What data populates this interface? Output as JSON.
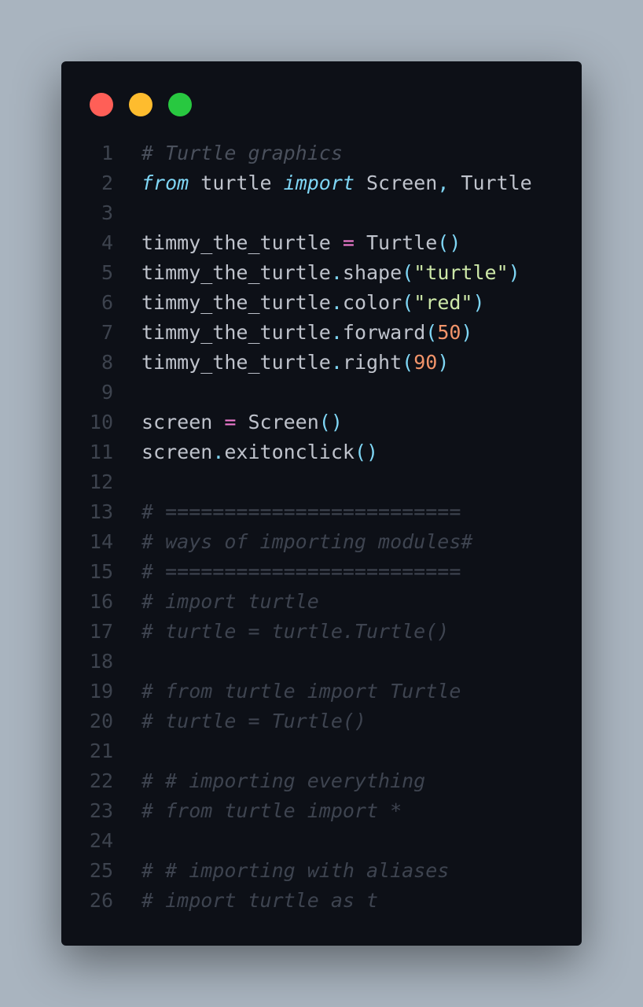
{
  "window": {
    "dots": [
      {
        "name": "close",
        "color": "#ff5f57"
      },
      {
        "name": "minimize",
        "color": "#febc2e"
      },
      {
        "name": "zoom",
        "color": "#28c840"
      }
    ]
  },
  "colors": {
    "background": "#a9b4bf",
    "editor": "#0d1017",
    "keyword": "#7fd6f5",
    "operator": "#f07bd0",
    "string": "#cde8a8",
    "number": "#f2946a",
    "comment": "#4a505c",
    "text": "#bfc3cc"
  },
  "lines": [
    {
      "n": "1",
      "tokens": [
        {
          "t": "comment",
          "v": "# Turtle graphics"
        }
      ]
    },
    {
      "n": "2",
      "tokens": [
        {
          "t": "kw",
          "v": "from"
        },
        {
          "t": "plain",
          "v": " turtle "
        },
        {
          "t": "kw",
          "v": "import"
        },
        {
          "t": "plain",
          "v": " Screen"
        },
        {
          "t": "punc",
          "v": ","
        },
        {
          "t": "plain",
          "v": " Turtle"
        }
      ]
    },
    {
      "n": "3",
      "tokens": []
    },
    {
      "n": "4",
      "tokens": [
        {
          "t": "plain",
          "v": "timmy_the_turtle "
        },
        {
          "t": "op",
          "v": "="
        },
        {
          "t": "plain",
          "v": " Turtle"
        },
        {
          "t": "punc",
          "v": "()"
        }
      ]
    },
    {
      "n": "5",
      "tokens": [
        {
          "t": "plain",
          "v": "timmy_the_turtle"
        },
        {
          "t": "punc",
          "v": "."
        },
        {
          "t": "plain",
          "v": "shape"
        },
        {
          "t": "punc",
          "v": "("
        },
        {
          "t": "str",
          "v": "\"turtle\""
        },
        {
          "t": "punc",
          "v": ")"
        }
      ]
    },
    {
      "n": "6",
      "tokens": [
        {
          "t": "plain",
          "v": "timmy_the_turtle"
        },
        {
          "t": "punc",
          "v": "."
        },
        {
          "t": "plain",
          "v": "color"
        },
        {
          "t": "punc",
          "v": "("
        },
        {
          "t": "str",
          "v": "\"red\""
        },
        {
          "t": "punc",
          "v": ")"
        }
      ]
    },
    {
      "n": "7",
      "tokens": [
        {
          "t": "plain",
          "v": "timmy_the_turtle"
        },
        {
          "t": "punc",
          "v": "."
        },
        {
          "t": "plain",
          "v": "forward"
        },
        {
          "t": "punc",
          "v": "("
        },
        {
          "t": "num",
          "v": "50"
        },
        {
          "t": "punc",
          "v": ")"
        }
      ]
    },
    {
      "n": "8",
      "tokens": [
        {
          "t": "plain",
          "v": "timmy_the_turtle"
        },
        {
          "t": "punc",
          "v": "."
        },
        {
          "t": "plain",
          "v": "right"
        },
        {
          "t": "punc",
          "v": "("
        },
        {
          "t": "num",
          "v": "90"
        },
        {
          "t": "punc",
          "v": ")"
        }
      ]
    },
    {
      "n": "9",
      "tokens": []
    },
    {
      "n": "10",
      "tokens": [
        {
          "t": "plain",
          "v": "screen "
        },
        {
          "t": "op",
          "v": "="
        },
        {
          "t": "plain",
          "v": " Screen"
        },
        {
          "t": "punc",
          "v": "()"
        }
      ]
    },
    {
      "n": "11",
      "tokens": [
        {
          "t": "plain",
          "v": "screen"
        },
        {
          "t": "punc",
          "v": "."
        },
        {
          "t": "plain",
          "v": "exitonclick"
        },
        {
          "t": "punc",
          "v": "()"
        }
      ]
    },
    {
      "n": "12",
      "tokens": []
    },
    {
      "n": "13",
      "tokens": [
        {
          "t": "comment-dim",
          "v": "# ========================="
        }
      ]
    },
    {
      "n": "14",
      "tokens": [
        {
          "t": "comment-dim",
          "v": "# ways of importing modules#"
        }
      ]
    },
    {
      "n": "15",
      "tokens": [
        {
          "t": "comment-dim",
          "v": "# ========================="
        }
      ]
    },
    {
      "n": "16",
      "tokens": [
        {
          "t": "comment-dim",
          "v": "# import turtle"
        }
      ]
    },
    {
      "n": "17",
      "tokens": [
        {
          "t": "comment-dim",
          "v": "# turtle = turtle.Turtle()"
        }
      ]
    },
    {
      "n": "18",
      "tokens": []
    },
    {
      "n": "19",
      "tokens": [
        {
          "t": "comment-dim",
          "v": "# from turtle import Turtle"
        }
      ]
    },
    {
      "n": "20",
      "tokens": [
        {
          "t": "comment-dim",
          "v": "# turtle = Turtle()"
        }
      ]
    },
    {
      "n": "21",
      "tokens": []
    },
    {
      "n": "22",
      "tokens": [
        {
          "t": "comment-dim",
          "v": "# # importing everything"
        }
      ]
    },
    {
      "n": "23",
      "tokens": [
        {
          "t": "comment-dim",
          "v": "# from turtle import *"
        }
      ]
    },
    {
      "n": "24",
      "tokens": []
    },
    {
      "n": "25",
      "tokens": [
        {
          "t": "comment-dim",
          "v": "# # importing with aliases"
        }
      ]
    },
    {
      "n": "26",
      "tokens": [
        {
          "t": "comment-dim",
          "v": "# import turtle as t"
        }
      ]
    }
  ]
}
